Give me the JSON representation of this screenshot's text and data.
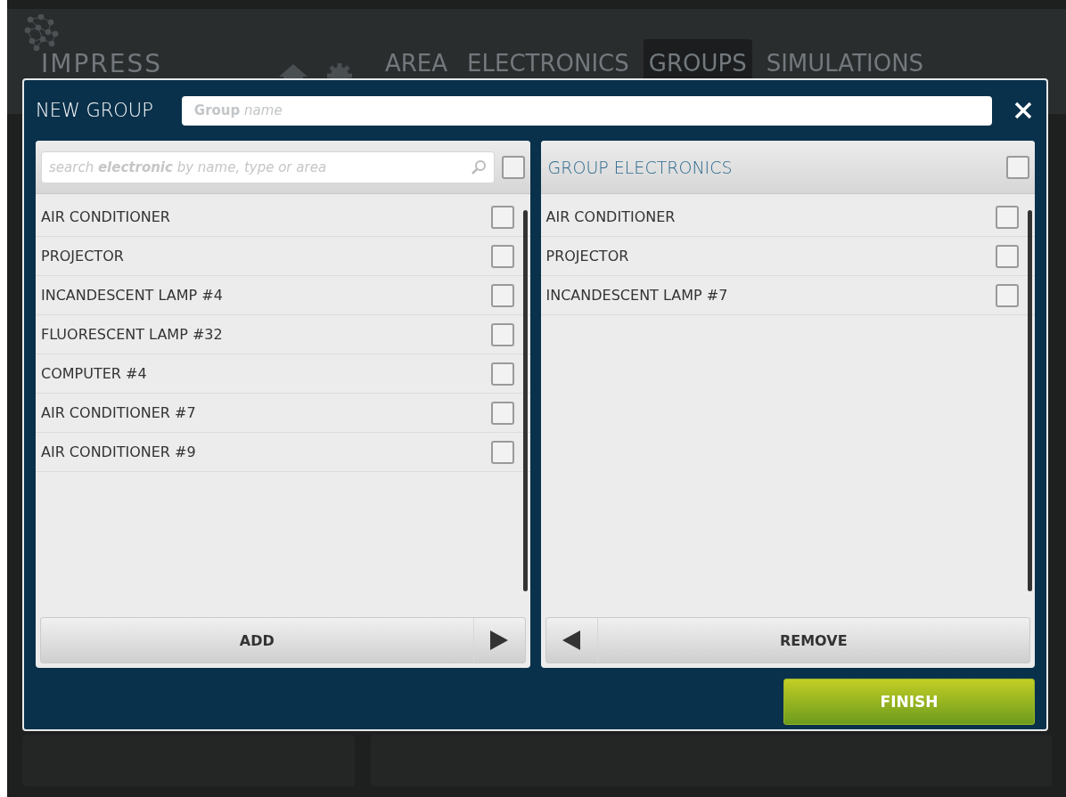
{
  "app": {
    "logo": "IMPRESS",
    "nav": [
      {
        "label": "AREA",
        "selected": false
      },
      {
        "label": "ELECTRONICS",
        "selected": false
      },
      {
        "label": "GROUPS",
        "selected": true
      },
      {
        "label": "SIMULATIONS",
        "selected": false
      }
    ]
  },
  "dialog": {
    "title": "NEW GROUP",
    "name_field": {
      "placeholder": "**Group** *name*"
    },
    "available": {
      "search": {
        "placeholder": "search **electronic** by name, type or area"
      },
      "select_all": {
        "checked": false
      },
      "items": [
        {
          "label": "AIR CONDITIONER",
          "checked": false
        },
        {
          "label": "PROJECTOR",
          "checked": false
        },
        {
          "label": "INCANDESCENT LAMP #4",
          "checked": false
        },
        {
          "label": "FLUORESCENT LAMP #32",
          "checked": false
        },
        {
          "label": "COMPUTER #4",
          "checked": false
        },
        {
          "label": "AIR CONDITIONER #7",
          "checked": false
        },
        {
          "label": "AIR CONDITIONER #9",
          "checked": false
        }
      ],
      "button": "ADD"
    },
    "group": {
      "title": "GROUP ELECTRONICS",
      "select_all": {
        "checked": false
      },
      "items": [
        {
          "label": "AIR CONDITIONER",
          "checked": false
        },
        {
          "label": "PROJECTOR",
          "checked": false
        },
        {
          "label": "INCANDESCENT LAMP #7",
          "checked": false
        }
      ],
      "button": "REMOVE"
    },
    "finish": "FINISH"
  }
}
